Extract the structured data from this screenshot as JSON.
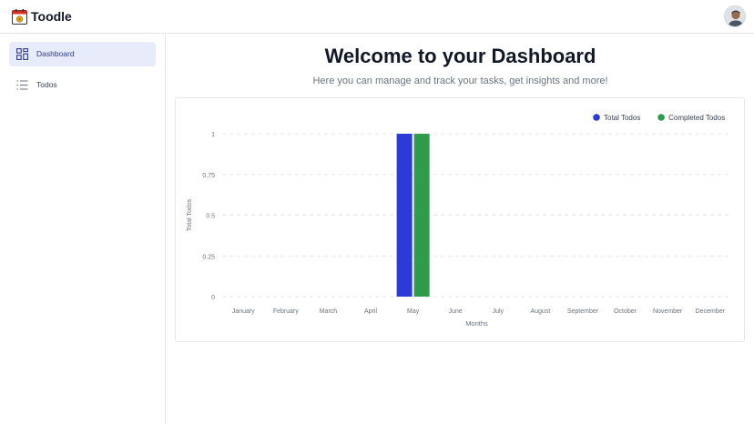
{
  "app": {
    "title": "Toodle"
  },
  "sidebar": {
    "items": [
      {
        "label": "Dashboard",
        "icon": "dashboard-icon",
        "active": true
      },
      {
        "label": "Todos",
        "icon": "list-icon",
        "active": false
      }
    ]
  },
  "main": {
    "title": "Welcome to your Dashboard",
    "subtitle": "Here you can manage and track your tasks, get insights and more!"
  },
  "colors": {
    "accent": "#2c3bd6",
    "completed": "#2e9c4a",
    "active_nav_bg": "#e8ebf9"
  },
  "chart_data": {
    "type": "bar",
    "categories": [
      "January",
      "February",
      "March",
      "April",
      "May",
      "June",
      "July",
      "August",
      "September",
      "October",
      "November",
      "December"
    ],
    "series": [
      {
        "name": "Total Todos",
        "color": "#2c3bd6",
        "values": [
          0,
          0,
          0,
          0,
          1,
          0,
          0,
          0,
          0,
          0,
          0,
          0
        ]
      },
      {
        "name": "Completed Todos",
        "color": "#2e9c4a",
        "values": [
          0,
          0,
          0,
          0,
          1,
          0,
          0,
          0,
          0,
          0,
          0,
          0
        ]
      }
    ],
    "xlabel": "Months",
    "ylabel": "Total Todos",
    "ylim": [
      0,
      1
    ],
    "yticks": [
      "0",
      "0.25",
      "0.5",
      "0.75",
      "1"
    ],
    "grid": true,
    "legend_position": "top-right"
  }
}
